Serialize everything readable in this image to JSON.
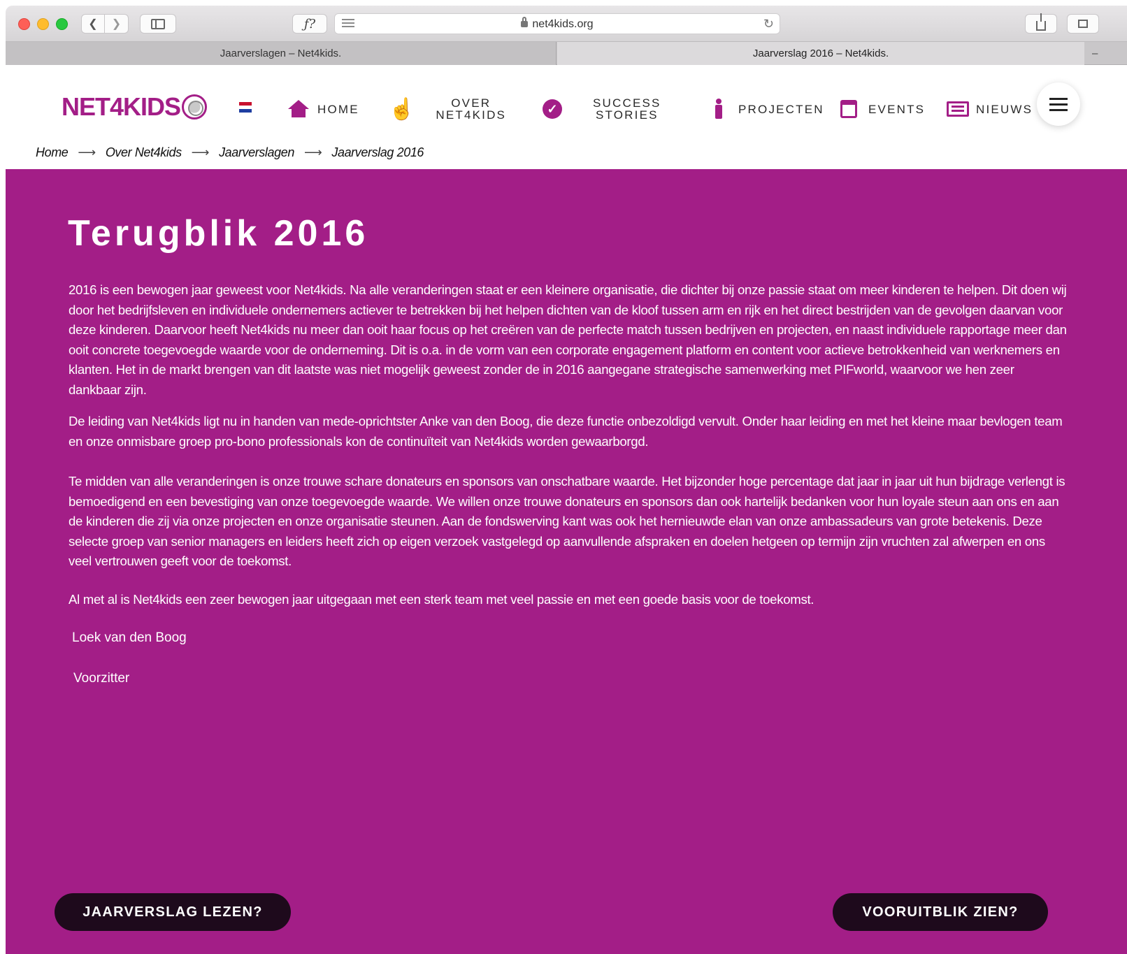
{
  "browser": {
    "url": "net4kids.org",
    "tabs": [
      {
        "label": "Jaarverslagen – Net4kids."
      },
      {
        "label": "Jaarverslag 2016 – Net4kids."
      }
    ]
  },
  "site": {
    "logo": "NET4KIDS",
    "nav": [
      {
        "label": "HOME",
        "icon": "home-icon"
      },
      {
        "label": "OVER NET4KIDS",
        "icon": "hand-pointer-icon"
      },
      {
        "label": "SUCCESS STORIES",
        "icon": "check-circle-icon"
      },
      {
        "label": "PROJECTEN",
        "icon": "person-icon"
      },
      {
        "label": "EVENTS",
        "icon": "calendar-icon"
      },
      {
        "label": "NIEUWS",
        "icon": "newspaper-icon"
      }
    ],
    "nav_over_lines": [
      "OVER",
      "NET4KIDS"
    ],
    "nav_success_lines": [
      "SUCCESS",
      "STORIES"
    ],
    "breadcrumb": [
      "Home",
      "Over Net4kids",
      "Jaarverslagen",
      "Jaarverslag 2016"
    ],
    "brand_color": "#a31e87"
  },
  "content": {
    "title": "Terugblik 2016",
    "paragraphs": [
      "2016 is een bewogen jaar geweest voor Net4kids. Na alle veranderingen staat er een kleinere organisatie, die dichter bij onze passie staat om meer kinderen te helpen. Dit doen wij door het bedrijfsleven en individuele ondernemers actiever te betrekken bij het helpen dichten van de kloof tussen arm en rijk en het direct bestrijden van de gevolgen daarvan voor deze kinderen. Daarvoor heeft Net4kids nu meer dan ooit haar focus op het creëren van de perfecte match tussen bedrijven en projecten, en naast individuele rapportage meer dan ooit concrete toegevoegde waarde voor de onderneming. Dit is o.a. in de vorm van een corporate engagement platform en content voor actieve betrokkenheid van werknemers en klanten. Het in de markt brengen van dit laatste was niet mogelijk geweest zonder de in 2016 aangegane strategische samenwerking met PIFworld, waarvoor we hen zeer dankbaar zijn.",
      "De leiding van Net4kids ligt nu in handen van mede-oprichtster Anke van den Boog, die deze functie onbezoldigd vervult. Onder haar leiding en met het kleine maar bevlogen team en onze onmisbare groep pro-bono professionals kon de continuïteit van Net4kids worden gewaarborgd.",
      "Te midden van alle veranderingen is onze trouwe schare donateurs en sponsors van onschatbare waarde. Het bijzonder hoge percentage dat jaar in jaar uit hun bijdrage verlengt is bemoedigend en een bevestiging van onze toegevoegde waarde. We willen onze trouwe donateurs en sponsors dan ook hartelijk bedanken voor hun loyale steun aan ons en aan de kinderen die zij via onze projecten en onze organisatie steunen. Aan de fondswerving kant was ook het hernieuwde elan van onze ambassadeurs van grote betekenis. Deze selecte groep van senior managers en leiders heeft zich op eigen verzoek vastgelegd op aanvullende afspraken en doelen hetgeen op termijn zijn vruchten zal afwerpen en ons veel vertrouwen geeft voor de toekomst.",
      "Al met al is Net4kids een zeer bewogen jaar uitgegaan met een sterk team met veel passie en met een goede basis voor de toekomst."
    ],
    "signature_name": "Loek van den Boog",
    "signature_role": "Voorzitter",
    "cta_left": "JAARVERSLAG LEZEN?",
    "cta_right": "VOORUITBLIK ZIEN?"
  }
}
